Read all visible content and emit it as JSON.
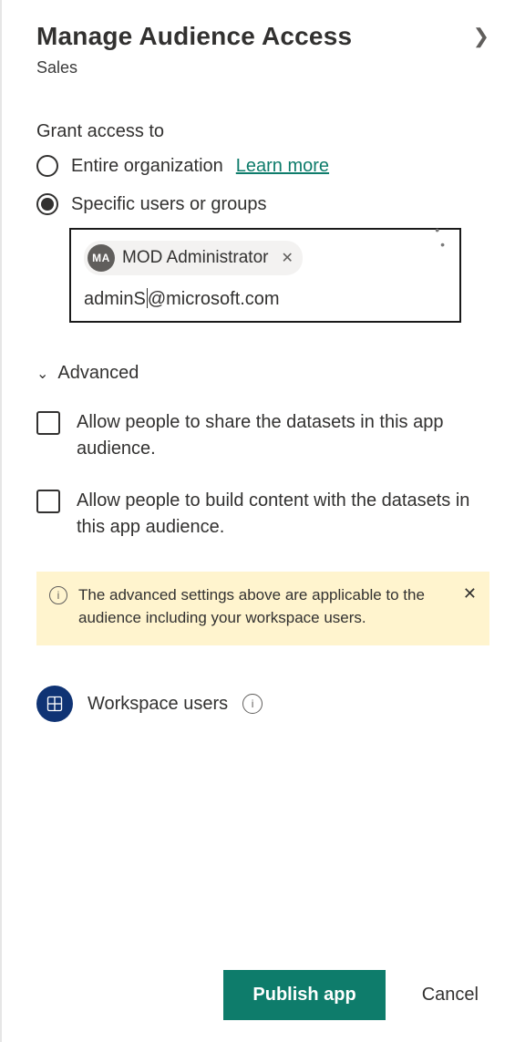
{
  "header": {
    "title": "Manage Audience Access",
    "subtitle": "Sales"
  },
  "grant": {
    "heading": "Grant access to",
    "option_org": "Entire organization",
    "learn_more": "Learn more",
    "option_specific": "Specific users or groups",
    "selected": "specific"
  },
  "picker": {
    "chip": {
      "initials": "MA",
      "name": "MOD Administrator"
    },
    "typed_before": "admin",
    "typed_after": "@microsoft.com"
  },
  "advanced": {
    "label": "Advanced",
    "cb_share": "Allow people to share the datasets in this app audience.",
    "cb_build": "Allow people to build content with the datasets in this app audience."
  },
  "banner": {
    "text": "The advanced settings above are applicable to the audience including your workspace users."
  },
  "workspace": {
    "label": "Workspace users"
  },
  "footer": {
    "publish": "Publish app",
    "cancel": "Cancel"
  }
}
